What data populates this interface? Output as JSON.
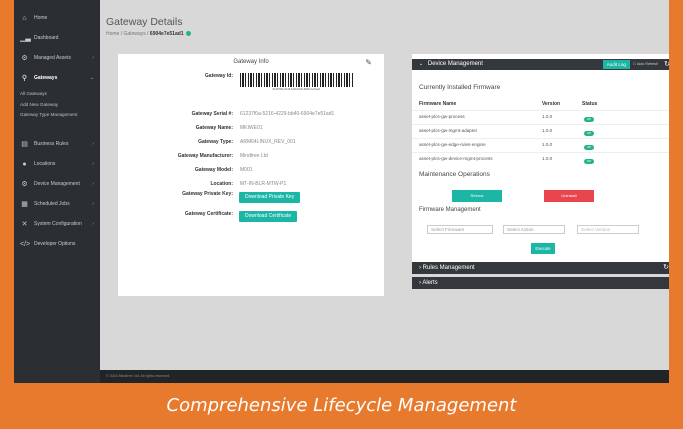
{
  "sidebar": {
    "items": [
      {
        "label": "Home",
        "icon": "home-icon",
        "glyph": "⌂"
      },
      {
        "label": "Dashboard",
        "icon": "chart-icon",
        "glyph": "▁▃"
      },
      {
        "label": "Managed Assets",
        "icon": "assets-icon",
        "glyph": "⚙"
      },
      {
        "label": "Gateways",
        "icon": "gateway-icon",
        "glyph": "⚲"
      }
    ],
    "gateway_sub": [
      "All Gateways",
      "Add New Gateway",
      "Gateway Type Management"
    ],
    "items2": [
      {
        "label": "Business Rules",
        "icon": "rules-icon",
        "glyph": "▤"
      },
      {
        "label": "Locations",
        "icon": "location-pin-icon",
        "glyph": "●"
      },
      {
        "label": "Device Management",
        "icon": "device-icon",
        "glyph": "⚙"
      },
      {
        "label": "Scheduled Jobs",
        "icon": "calendar-icon",
        "glyph": "▦"
      },
      {
        "label": "System Configuration",
        "icon": "tools-icon",
        "glyph": "✕"
      },
      {
        "label": "Developer Options",
        "icon": "code-icon",
        "glyph": "</>"
      }
    ]
  },
  "header": {
    "title": "Gateway Details",
    "breadcrumb_home": "Home",
    "breadcrumb_gateways": "Gateways",
    "breadcrumb_current": "6904e7e51ad1"
  },
  "info": {
    "title": "Gateway Info",
    "id_label": "Gateway Id:",
    "barcode_text": "6123780a-5216-4229-bb40-6904e7e51ad1",
    "fields": [
      {
        "k": "Gateway Serial #:",
        "v": "61237f0a-5216-4229-bb40-6904e7e51ad1"
      },
      {
        "k": "Gateway Name:",
        "v": "MKIWE01"
      },
      {
        "k": "Gateway Type:",
        "v": "ARM64LINUX_REV_001"
      },
      {
        "k": "Gateway Manufacturer:",
        "v": "Mindtree Ltd"
      },
      {
        "k": "Gateway Model:",
        "v": "M001"
      },
      {
        "k": "Location:",
        "v": "MT-IN-BLR-MTW-P1"
      }
    ],
    "private_key_label": "Gateway Private Key:",
    "private_key_button": "Download Private Key",
    "certificate_label": "Gateway Certificate:",
    "certificate_button": "Download Certificate"
  },
  "device_mgmt": {
    "title": "Device Management",
    "audit_button": "Audit Log",
    "auto_refresh": "Auto Refresh",
    "installed_title": "Currently Installed Firmware",
    "col_name": "Firmware Name",
    "col_version": "Version",
    "col_status": "Status",
    "firmware": [
      {
        "name": "asset-plcs-gw-process",
        "version": "1.0.0",
        "status": "UP"
      },
      {
        "name": "asset-plcs-gw-mgmt-adapter",
        "version": "1.0.0",
        "status": "UP"
      },
      {
        "name": "asset-plcs-gw-edge-rules-engine",
        "version": "1.0.0",
        "status": "UP"
      },
      {
        "name": "asset-plcs-gw-device-mgmt-process",
        "version": "1.0.0",
        "status": "UP"
      }
    ],
    "maintenance_title": "Maintenance Operations",
    "reboot_button": "Reboot",
    "uninstall_button": "Uninstall",
    "fw_mgmt_title": "Firmware Management",
    "select_firmware": "Select Firmware",
    "select_action": "Select Action",
    "select_version": "Select Version",
    "execute_button": "Execute"
  },
  "rules_panel": "Rules Management",
  "alerts_panel": "Alerts",
  "footer": "© 2016 Mindtree Ltd. All rights reserved.",
  "caption": "Comprehensive Lifecycle Management",
  "colors": {
    "accent": "#1bb6a5",
    "dark": "#34383d",
    "danger": "#e8454d",
    "caption_bg": "#e87a2e"
  }
}
